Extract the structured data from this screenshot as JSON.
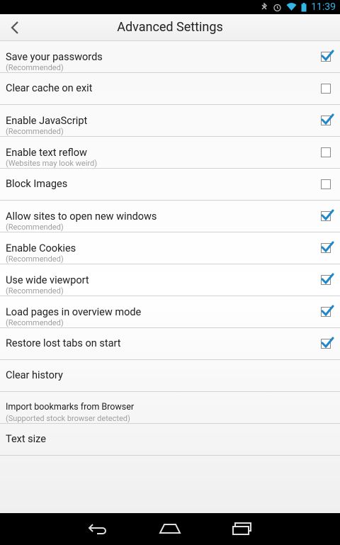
{
  "status_bar": {
    "time": "11:39"
  },
  "action_bar": {
    "title": "Advanced Settings"
  },
  "settings": [
    {
      "label": "Save your passwords",
      "subtitle": "(Recommended)",
      "checked": true
    },
    {
      "label": "Clear cache on exit",
      "subtitle": null,
      "checked": false
    },
    {
      "label": "Enable JavaScript",
      "subtitle": "(Recommended)",
      "checked": true
    },
    {
      "label": "Enable text reflow",
      "subtitle": "(Websites may look weird)",
      "checked": false
    },
    {
      "label": "Block Images",
      "subtitle": null,
      "checked": false
    },
    {
      "label": "Allow sites to open new windows",
      "subtitle": "(Recommended)",
      "checked": true
    },
    {
      "label": "Enable Cookies",
      "subtitle": "(Recommended)",
      "checked": true
    },
    {
      "label": "Use wide viewport",
      "subtitle": "(Recommended)",
      "checked": true
    },
    {
      "label": "Load pages in overview mode",
      "subtitle": "(Recommended)",
      "checked": true
    },
    {
      "label": "Restore lost tabs on start",
      "subtitle": null,
      "checked": true
    },
    {
      "label": "Clear history",
      "subtitle": null,
      "checked": null
    },
    {
      "label": "Import bookmarks from Browser",
      "subtitle": "(Supported stock browser detected)",
      "checked": null
    },
    {
      "label": "Text size",
      "subtitle": null,
      "checked": null
    }
  ],
  "icons": {
    "back": "chevron-left-icon",
    "nav_back": "back-arrow-icon",
    "nav_home": "home-icon",
    "nav_recents": "recent-apps-icon"
  },
  "colors": {
    "accent": "#33b5e5",
    "check": "#1e88c9"
  }
}
